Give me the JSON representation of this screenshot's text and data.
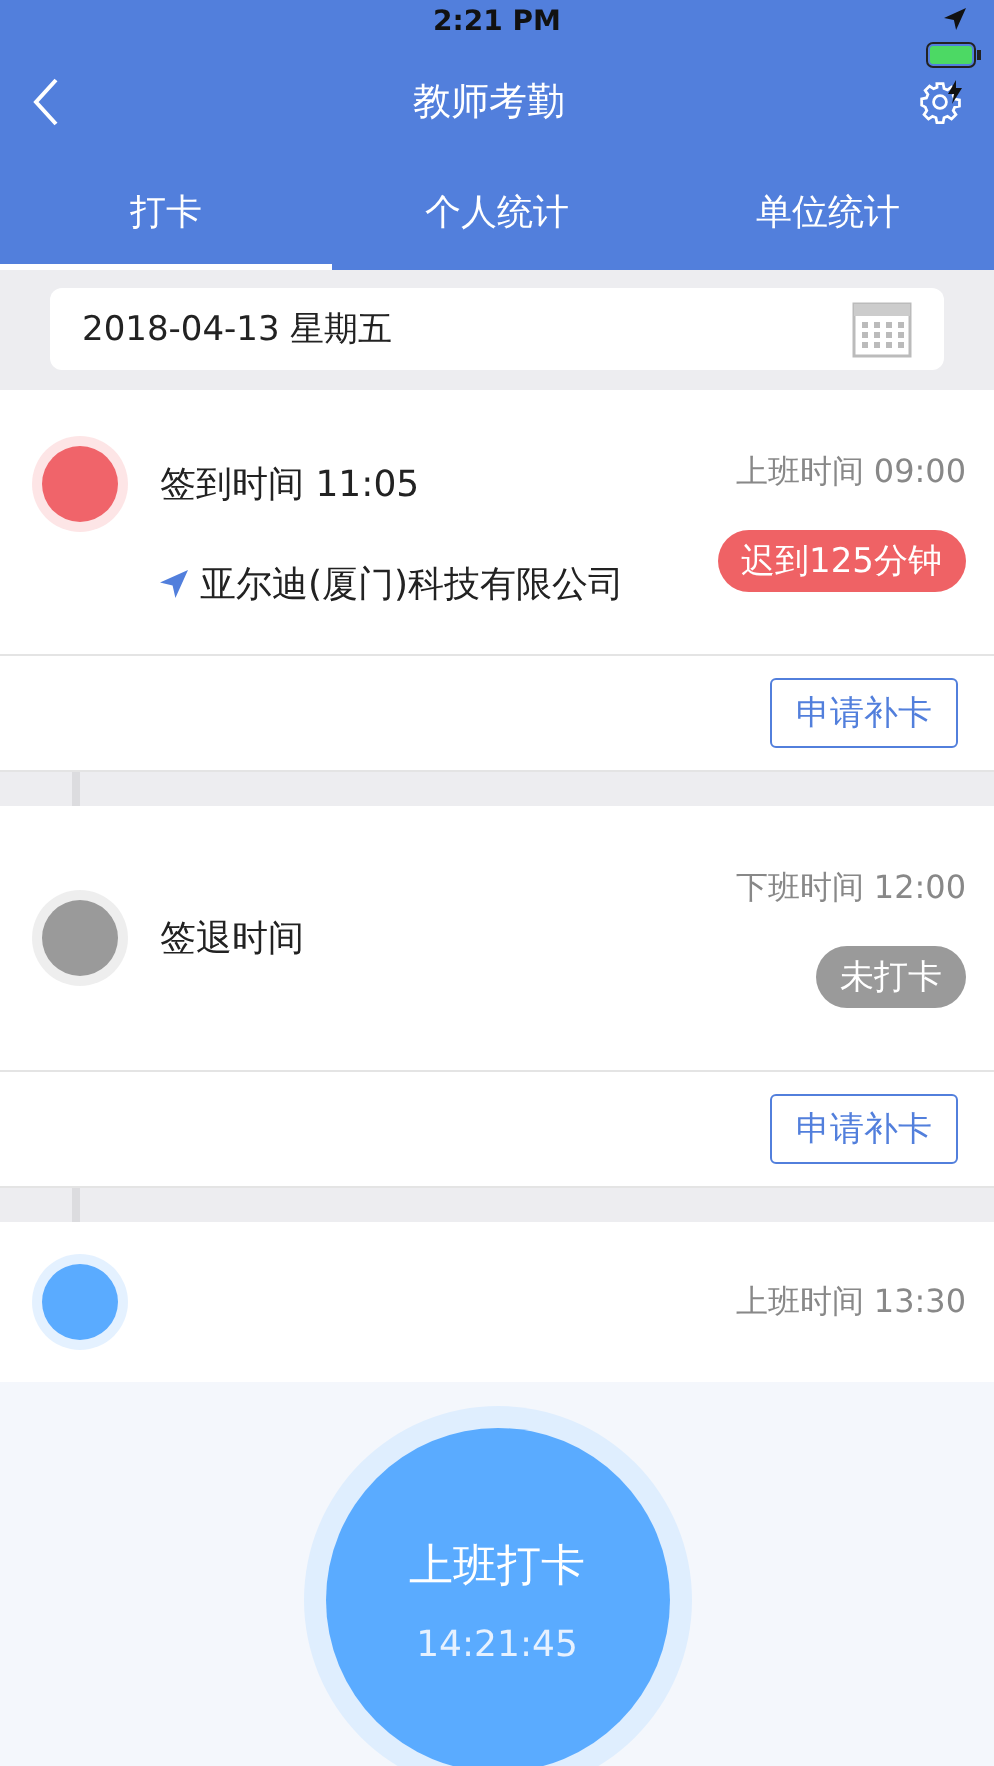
{
  "status_bar": {
    "time": "2:21 PM"
  },
  "nav": {
    "title": "教师考勤"
  },
  "tabs": [
    {
      "label": "打卡",
      "selected": true
    },
    {
      "label": "个人统计",
      "selected": false
    },
    {
      "label": "单位统计",
      "selected": false
    }
  ],
  "date_field": {
    "value": "2018-04-13 星期五"
  },
  "records": [
    {
      "color": "#f0646a",
      "label": "签到时间 11:05",
      "location": "亚尔迪(厦门)科技有限公司",
      "schedule": "上班时间 09:00",
      "badge": {
        "text": "迟到125分钟",
        "color": "#ef6265"
      },
      "button": "申请补卡"
    },
    {
      "color": "#9a9a9a",
      "label": "签退时间",
      "schedule": "下班时间 12:00",
      "badge": {
        "text": "未打卡",
        "color": "#9a9a9a"
      },
      "button": "申请补卡"
    },
    {
      "color": "#5aabff",
      "schedule": "上班时间 13:30"
    }
  ],
  "punch": {
    "label": "上班打卡",
    "time": "14:21:45"
  }
}
